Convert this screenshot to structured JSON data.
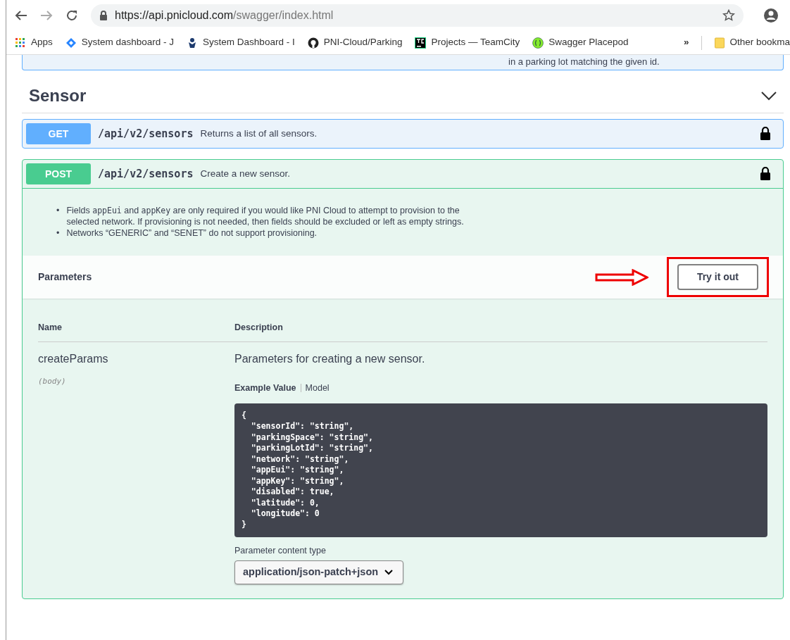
{
  "browser": {
    "url_host": "https://api.pnicloud.com",
    "url_path": "/swagger/index.html",
    "bookmarks": [
      {
        "label": "Apps",
        "kind": "apps"
      },
      {
        "label": "System dashboard - J",
        "kind": "diamond"
      },
      {
        "label": "System Dashboard - I",
        "kind": "jira"
      },
      {
        "label": "PNI-Cloud/Parking",
        "kind": "github"
      },
      {
        "label": "Projects — TeamCity",
        "kind": "tc"
      },
      {
        "label": "Swagger Placepod",
        "kind": "swagger"
      }
    ],
    "overflow": "»",
    "other_bookmarks": "Other bookma"
  },
  "previous_operation": {
    "summary_fragment": "in a parking lot matching the given id."
  },
  "section": {
    "title": "Sensor",
    "expanded": true
  },
  "operations": [
    {
      "method": "GET",
      "path": "/api/v2/sensors",
      "summary": "Returns a list of all sensors.",
      "expanded": false
    },
    {
      "method": "POST",
      "path": "/api/v2/sensors",
      "summary": "Create a new sensor.",
      "expanded": true,
      "notes": [
        {
          "marker": "•",
          "parts": [
            {
              "kind": "text",
              "text": "Fields "
            },
            {
              "kind": "code",
              "text": "appEui"
            },
            {
              "kind": "text",
              "text": " and "
            },
            {
              "kind": "code",
              "text": "appKey"
            },
            {
              "kind": "text",
              "text": " are only required if you would like PNI Cloud to attempt to provision to the selected network. If provisioning is not needed, then fields should be excluded or left as empty strings."
            }
          ]
        },
        {
          "marker": "•",
          "parts": [
            {
              "kind": "text",
              "text": "Networks “GENERIC” and “SENET” do not support provisioning."
            }
          ]
        }
      ],
      "parameters_title": "Parameters",
      "try_button": {
        "label": "Try it out",
        "highlighted": true
      },
      "columns": [
        "Name",
        "Description"
      ],
      "params": [
        {
          "name": "createParams",
          "location": "(body)",
          "description": "Parameters for creating a new sensor.",
          "example_tabs": [
            {
              "label": "Example Value",
              "selected": true
            },
            {
              "label": "Model",
              "selected": false
            }
          ],
          "example": "{\n  \"sensorId\": \"string\",\n  \"parkingSpace\": \"string\",\n  \"parkingLotId\": \"string\",\n  \"network\": \"string\",\n  \"appEui\": \"string\",\n  \"appKey\": \"string\",\n  \"disabled\": true,\n  \"latitude\": 0,\n  \"longitude\": 0\n}",
          "content_type_label": "Parameter content type",
          "content_type": "application/json-patch+json"
        }
      ]
    }
  ]
}
